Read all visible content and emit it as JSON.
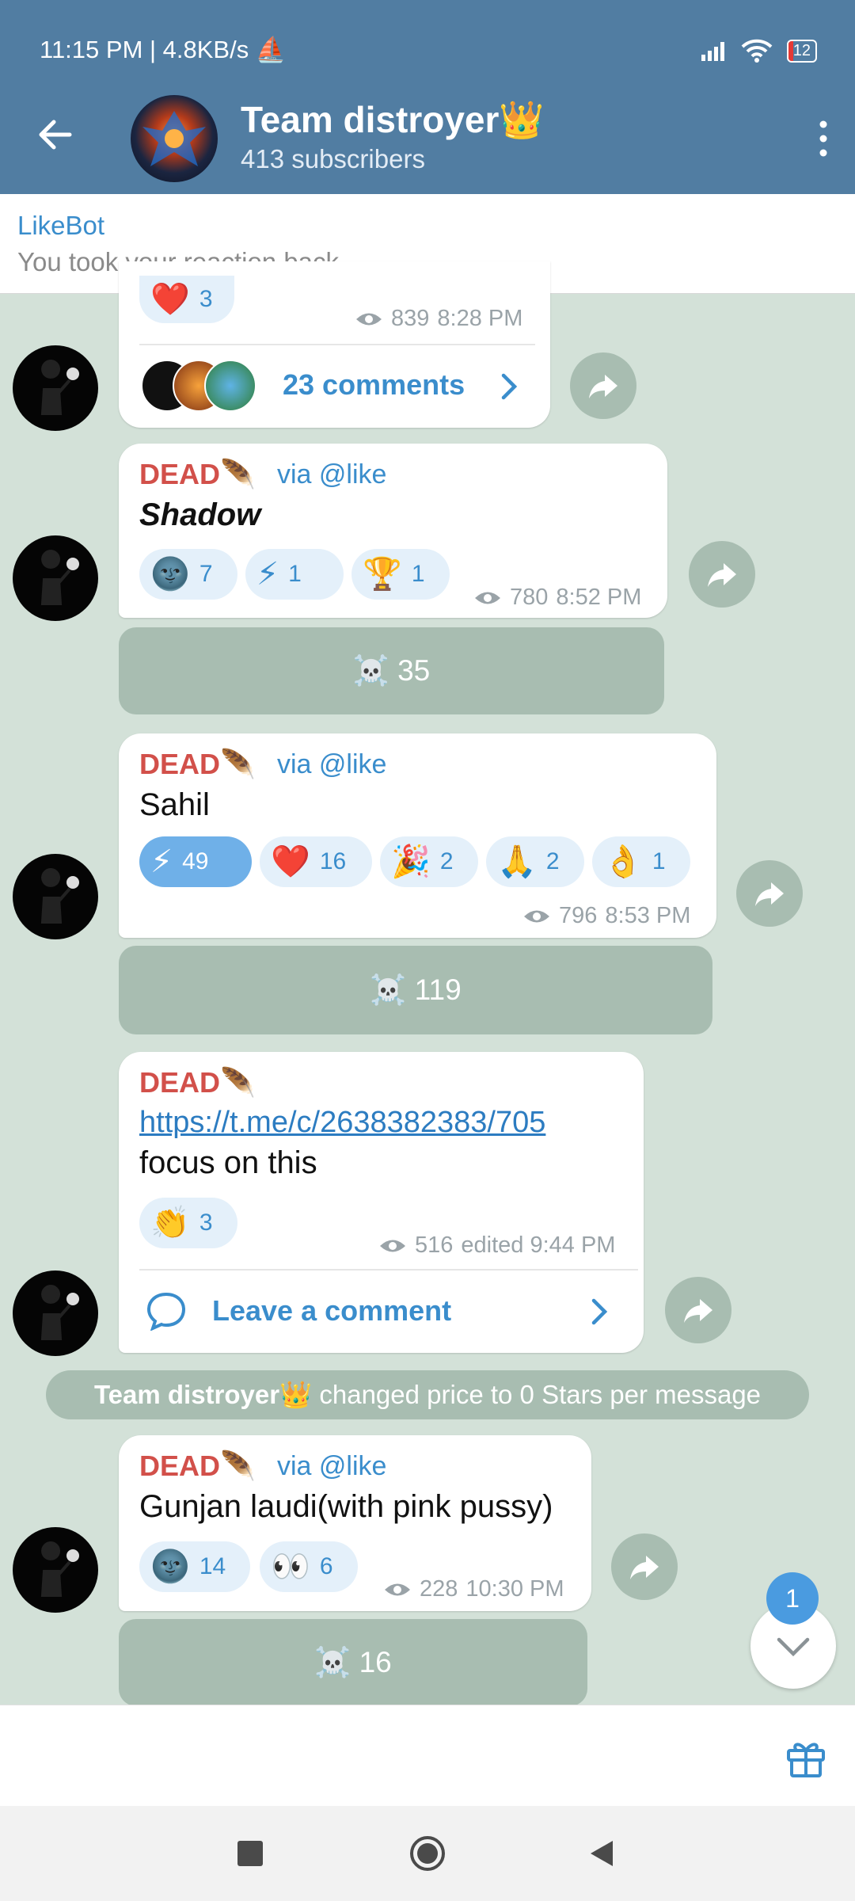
{
  "status": {
    "time": "11:15 PM | 4.8KB/s",
    "battery": "12"
  },
  "channel": {
    "title": "Team distroyer",
    "crown": "👑",
    "subtitle": "413 subscribers"
  },
  "pinned": {
    "title": "LikeBot",
    "text": "You took your reaction back."
  },
  "msg0": {
    "reaction_emoji": "❤️",
    "reaction_count": "3",
    "views": "839",
    "time": "8:28 PM",
    "comments": "23 comments"
  },
  "msg1": {
    "sender": "DEAD",
    "sender_emoji": "🪶",
    "via": "via @like",
    "text": "Shadow",
    "reactions": [
      {
        "e": "🌚",
        "n": "7"
      },
      {
        "e": "⚡",
        "n": "1"
      },
      {
        "e": "🏆",
        "n": "1"
      }
    ],
    "views": "780",
    "time": "8:52 PM",
    "button_label": "☠️ 35"
  },
  "msg2": {
    "sender": "DEAD",
    "sender_emoji": "🪶",
    "via": "via @like",
    "text": "Sahil",
    "reactions": [
      {
        "e": "⚡",
        "n": "49"
      },
      {
        "e": "❤️",
        "n": "16"
      },
      {
        "e": "🎉",
        "n": "2"
      },
      {
        "e": "🙏",
        "n": "2"
      },
      {
        "e": "👌",
        "n": "1"
      }
    ],
    "views": "796",
    "time": "8:53 PM",
    "button_label": "☠️ 119"
  },
  "msg3": {
    "sender": "DEAD",
    "sender_emoji": "🪶",
    "link": "https://t.me/c/2638382383/705",
    "text": "focus on this",
    "reactions": [
      {
        "e": "👏",
        "n": "3"
      }
    ],
    "views": "516",
    "time": "edited 9:44 PM",
    "comment_label": "Leave a comment"
  },
  "service": {
    "name": "Team distroyer",
    "crown": "👑",
    "text": "changed price to 0 Stars per message"
  },
  "msg4": {
    "sender": "DEAD",
    "sender_emoji": "🪶",
    "via": "via @like",
    "text": "Gunjan laudi(with pink pussy)",
    "reactions": [
      {
        "e": "🌚",
        "n": "14"
      },
      {
        "e": "👀",
        "n": "6"
      }
    ],
    "views": "228",
    "time": "10:30 PM",
    "button_label": "☠️ 16"
  },
  "scroll": {
    "badge": "1"
  },
  "colors": {
    "header": "#517da2",
    "chat_bg": "#d3e1d8",
    "accent": "#3a8dcc",
    "sender": "#d2504a",
    "button_bg": "#a8bdb1"
  }
}
